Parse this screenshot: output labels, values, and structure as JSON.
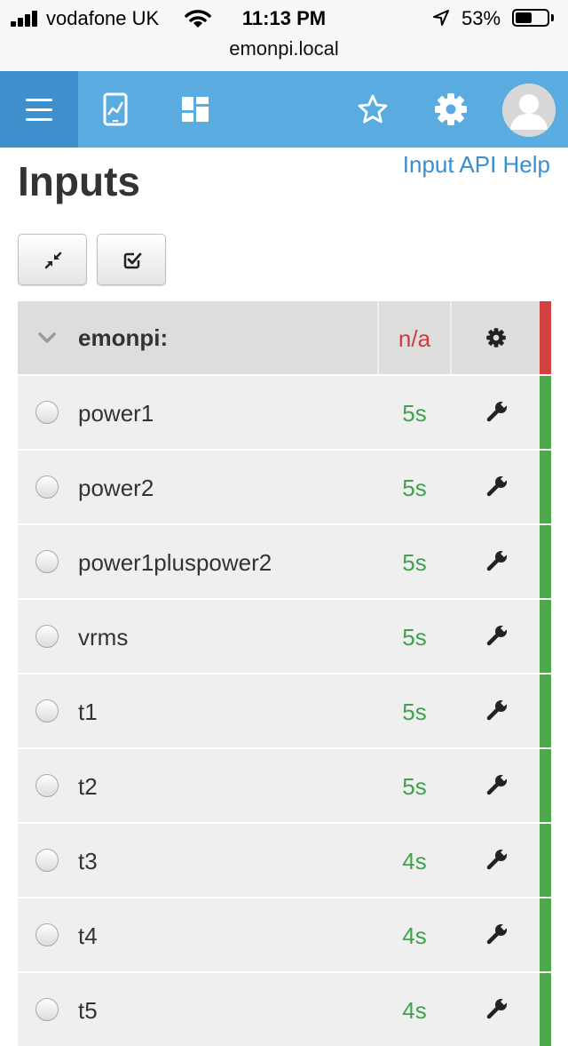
{
  "status_bar": {
    "carrier": "vodafone UK",
    "time": "11:13 PM",
    "battery": "53%",
    "battery_level": 0.53,
    "url": "emonpi.local"
  },
  "navbar": {
    "icons": [
      "menu-icon",
      "phone-graph-icon",
      "dashboard-icon",
      "star-icon",
      "gear-icon",
      "user-avatar-icon"
    ]
  },
  "page": {
    "title": "Inputs",
    "api_help": "Input API Help",
    "toolbar": {
      "collapse_icon": "collapse-arrows-icon",
      "select_icon": "checkbox-icon"
    }
  },
  "group": {
    "name": "emonpi:",
    "time": "n/a",
    "status_color": "#d24040"
  },
  "inputs": [
    {
      "name": "power1",
      "time": "5s"
    },
    {
      "name": "power2",
      "time": "5s"
    },
    {
      "name": "power1pluspower2",
      "time": "5s"
    },
    {
      "name": "vrms",
      "time": "5s"
    },
    {
      "name": "t1",
      "time": "5s"
    },
    {
      "name": "t2",
      "time": "5s"
    },
    {
      "name": "t3",
      "time": "4s"
    },
    {
      "name": "t4",
      "time": "4s"
    },
    {
      "name": "t5",
      "time": "4s"
    }
  ],
  "colors": {
    "nav_bar": "#5aace0",
    "nav_menu_active": "#3f8fcd",
    "link": "#3a8fcf",
    "time_ok": "#3ea34b",
    "time_na": "#cc3d3d",
    "status_ok": "#4caa4a",
    "status_inactive": "#d24040"
  }
}
